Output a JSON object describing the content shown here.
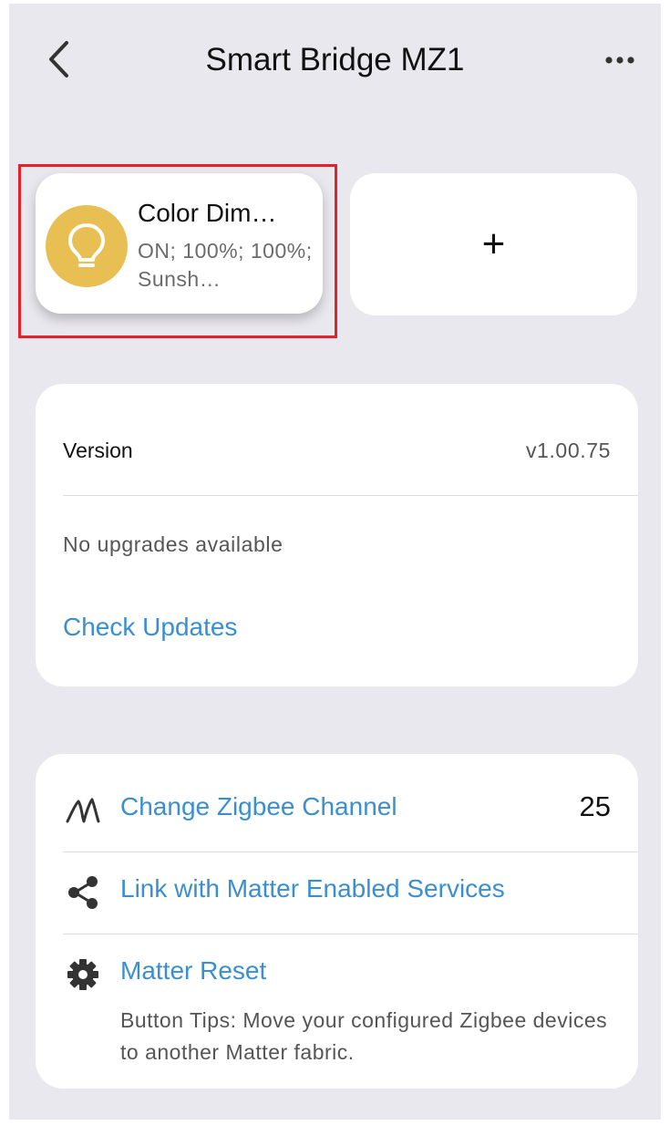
{
  "header": {
    "title": "Smart Bridge MZ1"
  },
  "devices": [
    {
      "name": "Color Dim…",
      "status": "ON; 100%; 100%; Sunsh…",
      "icon": "light-bulb-icon",
      "icon_color": "#e8bf52"
    }
  ],
  "add_tile": {
    "label": "+"
  },
  "version_card": {
    "version_label": "Version",
    "version_value": "v1.00.75",
    "upgrade_status": "No upgrades available",
    "check_updates_label": "Check Updates"
  },
  "settings_card": {
    "zigbee_channel_label": "Change Zigbee Channel",
    "zigbee_channel_value": "25",
    "link_matter_label": "Link with Matter Enabled Services",
    "matter_reset_label": "Matter Reset",
    "button_tips": "Button Tips: Move your configured Zigbee devices to another Matter fabric."
  },
  "colors": {
    "background": "#e9e8ee",
    "link": "#3b8fd0",
    "highlight": "#e3222a"
  }
}
